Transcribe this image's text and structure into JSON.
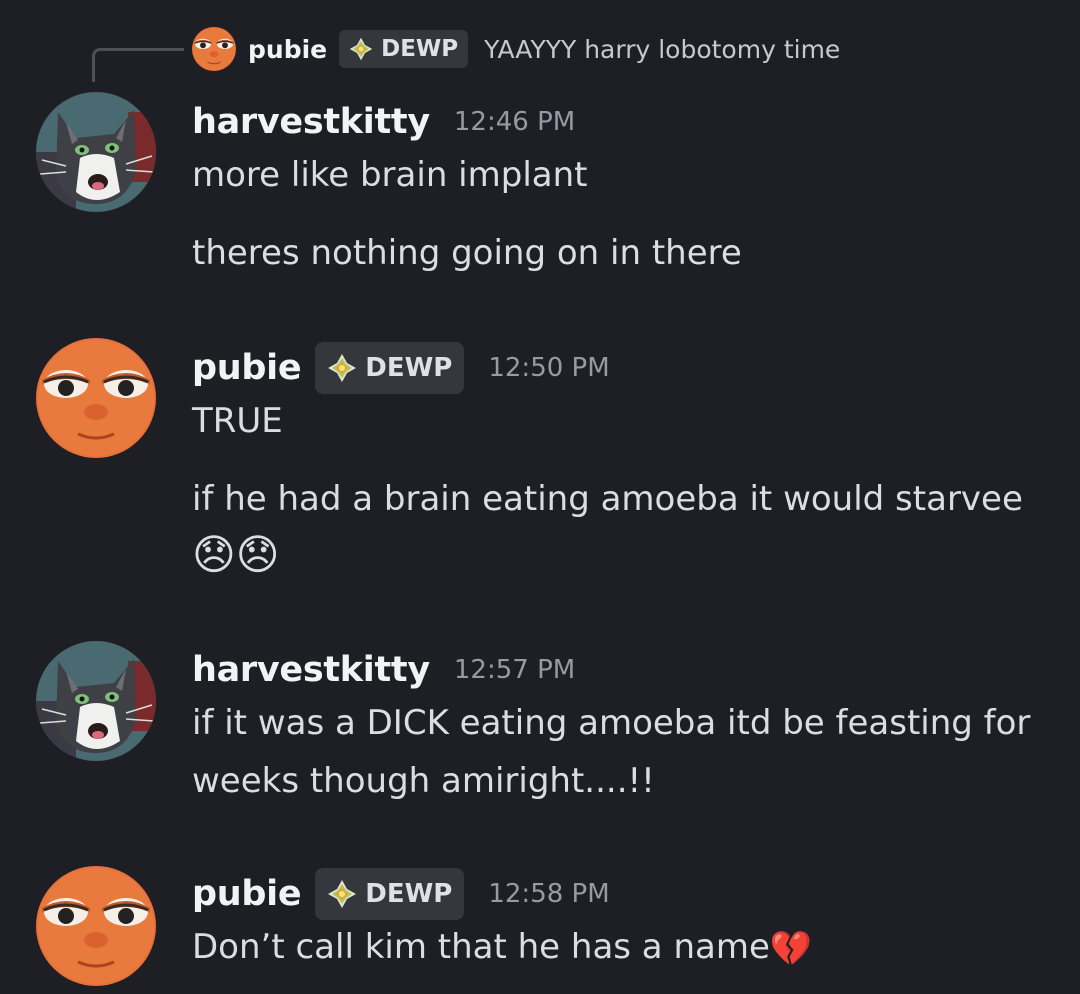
{
  "reply": {
    "author": "pubie",
    "tag": "DEWP",
    "text": "YAAYYY harry lobotomy time"
  },
  "messages": [
    {
      "author": "harvestkitty",
      "timestamp": "12:46 PM",
      "lines": [
        "more like brain implant",
        "theres nothing going on in there"
      ]
    },
    {
      "author": "pubie",
      "tag": "DEWP",
      "timestamp": "12:50 PM",
      "lines": [
        "TRUE",
        "if he had a brain eating amoeba it would starvee"
      ],
      "emoji_line": "😞😞"
    },
    {
      "author": "harvestkitty",
      "timestamp": "12:57 PM",
      "lines": [
        "if it was a DICK eating amoeba itd be feasting for",
        "weeks though amiright....!!"
      ]
    },
    {
      "author": "pubie",
      "tag": "DEWP",
      "timestamp": "12:58 PM",
      "lines": [
        "Don’t call kim that he has a name"
      ],
      "emoji": "💔"
    }
  ],
  "colors": {
    "background": "#1e1f24",
    "username": "#f2f3f5",
    "timestamp": "#949ba4",
    "tag_bg": "#35373c"
  },
  "icons": {
    "tag": "diamond-gem-icon",
    "pubie_avatar": "sleepy-orange-face-avatar",
    "harvestkitty_avatar": "cat-avatar"
  }
}
